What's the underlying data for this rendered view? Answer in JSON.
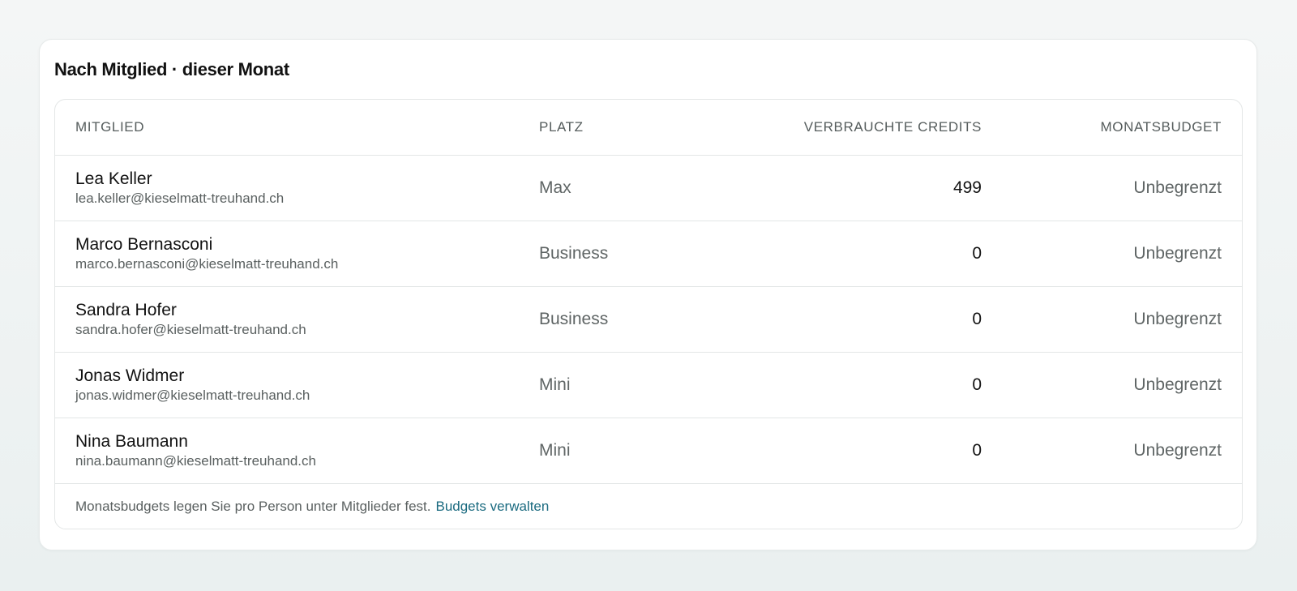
{
  "card": {
    "title": "Nach Mitglied · dieser Monat"
  },
  "table": {
    "columns": {
      "member": "Mitglied",
      "seat": "Platz",
      "credits": "Verbrauchte Credits",
      "budget": "Monatsbudget"
    },
    "rows": [
      {
        "name": "Lea Keller",
        "email": "lea.keller@kieselmatt-treuhand.ch",
        "seat": "Max",
        "credits": "499",
        "budget": "Unbegrenzt"
      },
      {
        "name": "Marco Bernasconi",
        "email": "marco.bernasconi@kieselmatt-treuhand.ch",
        "seat": "Business",
        "credits": "0",
        "budget": "Unbegrenzt"
      },
      {
        "name": "Sandra Hofer",
        "email": "sandra.hofer@kieselmatt-treuhand.ch",
        "seat": "Business",
        "credits": "0",
        "budget": "Unbegrenzt"
      },
      {
        "name": "Jonas Widmer",
        "email": "jonas.widmer@kieselmatt-treuhand.ch",
        "seat": "Mini",
        "credits": "0",
        "budget": "Unbegrenzt"
      },
      {
        "name": "Nina Baumann",
        "email": "nina.baumann@kieselmatt-treuhand.ch",
        "seat": "Mini",
        "credits": "0",
        "budget": "Unbegrenzt"
      }
    ]
  },
  "footer": {
    "text": "Monatsbudgets legen Sie pro Person unter Mitglieder fest.",
    "link_label": "Budgets verwalten"
  },
  "colors": {
    "link": "#1b6b80",
    "border": "#e3e6e6",
    "background": "#eef2f2"
  }
}
